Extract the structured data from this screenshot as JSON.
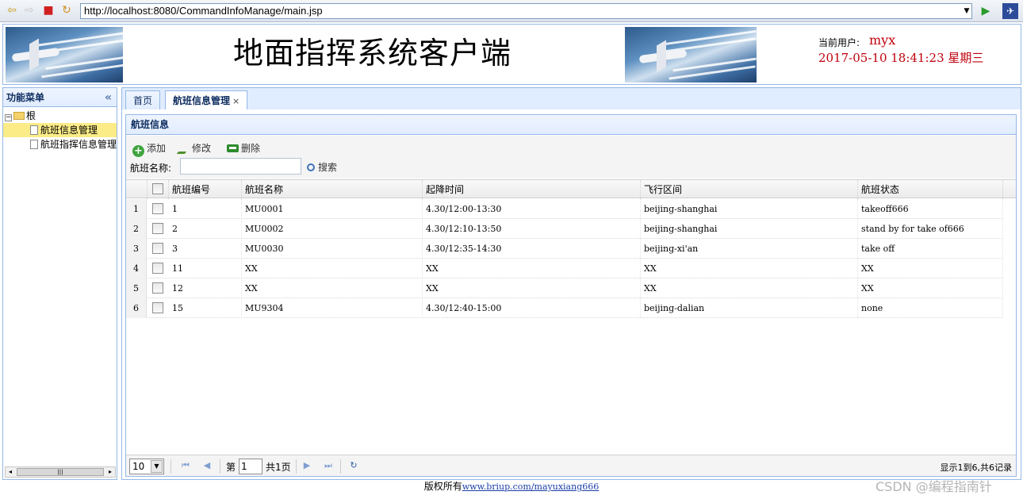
{
  "browser": {
    "url": "http://localhost:8080/CommandInfoManage/main.jsp"
  },
  "header": {
    "title": "地面指挥系统客户端",
    "user_label": "当前用户:",
    "user_name": "myx",
    "datetime": "2017-05-10 18:41:23 星期三"
  },
  "sidebar": {
    "title": "功能菜单",
    "root": "根",
    "items": [
      {
        "label": "航班信息管理",
        "selected": true
      },
      {
        "label": "航班指挥信息管理",
        "selected": false
      }
    ]
  },
  "tabs": [
    {
      "label": "首页",
      "active": false
    },
    {
      "label": "航班信息管理",
      "active": true,
      "close": "×"
    }
  ],
  "panel": {
    "title": "航班信息",
    "toolbar": {
      "add": "添加",
      "edit": "修改",
      "delete": "删除",
      "search_label": "航班名称:",
      "search_value": "",
      "search_button": "搜索"
    }
  },
  "grid": {
    "columns": [
      "航班编号",
      "航班名称",
      "起降时间",
      "飞行区间",
      "航班状态"
    ],
    "rows": [
      {
        "n": "1",
        "id": "1",
        "name": "MU0001",
        "time": "4.30/12:00-13:30",
        "route": "beijing-shanghai",
        "status": "takeoff666"
      },
      {
        "n": "2",
        "id": "2",
        "name": "MU0002",
        "time": "4.30/12:10-13:50",
        "route": "beijing-shanghai",
        "status": "stand by for take of666"
      },
      {
        "n": "3",
        "id": "3",
        "name": "MU0030",
        "time": "4.30/12:35-14:30",
        "route": "beijing-xi'an",
        "status": "take off"
      },
      {
        "n": "4",
        "id": "11",
        "name": "XX",
        "time": "XX",
        "route": "XX",
        "status": "XX"
      },
      {
        "n": "5",
        "id": "12",
        "name": "XX",
        "time": "XX",
        "route": "XX",
        "status": "XX"
      },
      {
        "n": "6",
        "id": "15",
        "name": "MU9304",
        "time": "4.30/12:40-15:00",
        "route": "beijing-dalian",
        "status": "none"
      }
    ]
  },
  "pager": {
    "page_size": "10",
    "page_prefix": "第",
    "page_number": "1",
    "page_suffix": "共1页",
    "info": "显示1到6,共6记录"
  },
  "footer": {
    "text": "版权所有",
    "link": "www.briup.com/mayuxiang666"
  },
  "watermark": "CSDN @编程指南针"
}
